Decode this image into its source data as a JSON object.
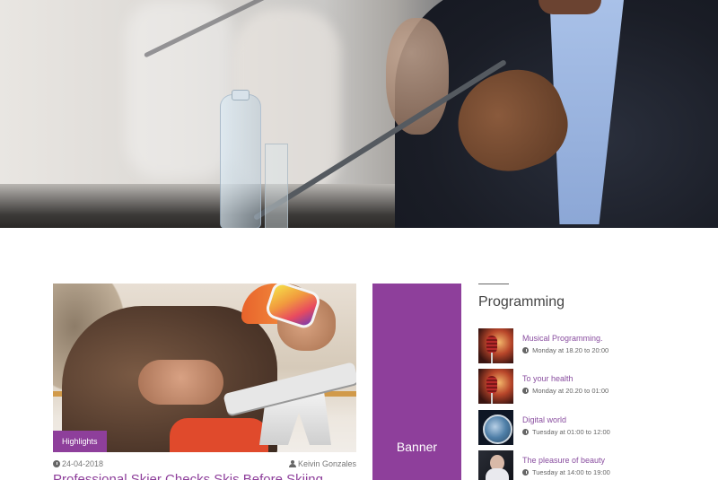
{
  "hero": {
    "image": "conference-speaker-with-microphone"
  },
  "article": {
    "image": "skier-checking-skis",
    "badge": "Highlights",
    "date": "24-04-2018",
    "author": "Keivin Gonzales",
    "title": "Professional Skier Checks Skis Before Skiing"
  },
  "banner": {
    "label": "Banner",
    "color": "#8e3f9b"
  },
  "programming": {
    "title": "Programming",
    "items": [
      {
        "title": "Musical Programming.",
        "time": "Monday at 18.20 to 20:00",
        "thumb": "microphone"
      },
      {
        "title": "To your health",
        "time": "Monday at 20.20 to 01:00",
        "thumb": "microphone"
      },
      {
        "title": "Digital world",
        "time": "Tuesday at 01:00 to 12:00",
        "thumb": "globe"
      },
      {
        "title": "The pleasure of beauty",
        "time": "Tuesday at 14:00 to 19:00",
        "thumb": "woman-portrait"
      }
    ]
  },
  "colors": {
    "accent": "#8e3f9b"
  }
}
